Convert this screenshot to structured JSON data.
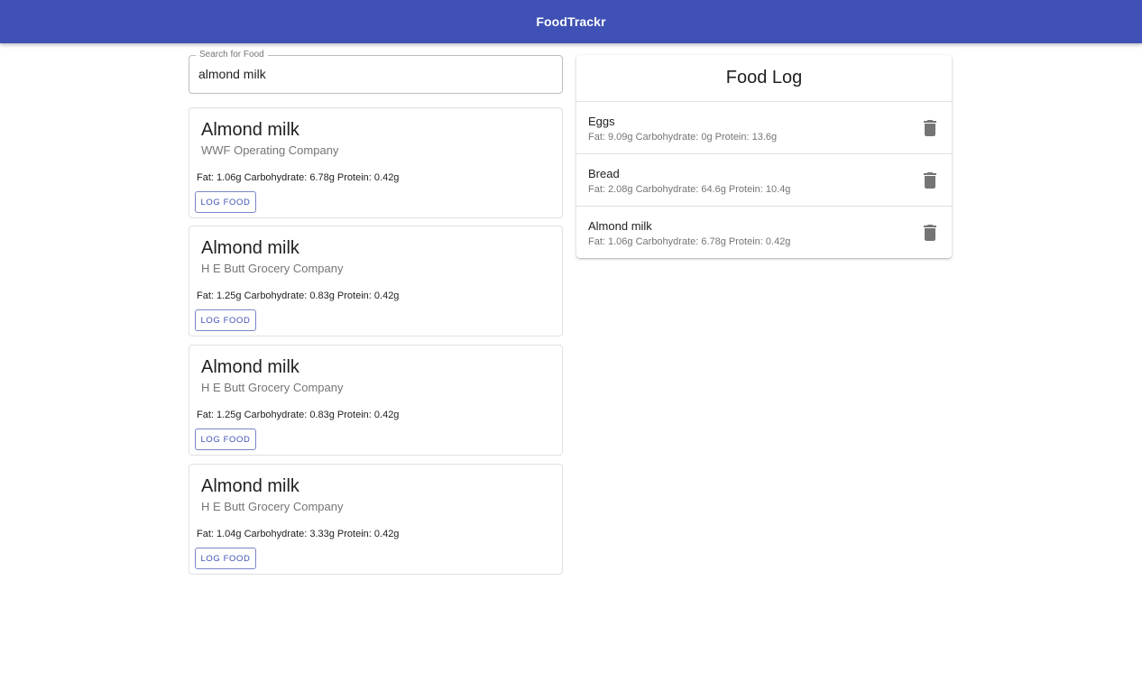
{
  "app": {
    "title": "FoodTrackr",
    "brand_color": "#3f51b5"
  },
  "search": {
    "label": "Search for Food",
    "value": "almond milk"
  },
  "results": [
    {
      "name": "Almond milk",
      "brand": "WWF Operating Company",
      "macros": "Fat: 1.06g Carbohydrate: 6.78g Protein: 0.42g",
      "button_label": "LOG FOOD"
    },
    {
      "name": "Almond milk",
      "brand": "H E Butt Grocery Company",
      "macros": "Fat: 1.25g Carbohydrate: 0.83g Protein: 0.42g",
      "button_label": "LOG FOOD"
    },
    {
      "name": "Almond milk",
      "brand": "H E Butt Grocery Company",
      "macros": "Fat: 1.25g Carbohydrate: 0.83g Protein: 0.42g",
      "button_label": "LOG FOOD"
    },
    {
      "name": "Almond milk",
      "brand": "H E Butt Grocery Company",
      "macros": "Fat: 1.04g Carbohydrate: 3.33g Protein: 0.42g",
      "button_label": "LOG FOOD"
    }
  ],
  "food_log": {
    "title": "Food Log",
    "delete_icon": "trash-icon",
    "items": [
      {
        "name": "Eggs",
        "macros": "Fat: 9.09g Carbohydrate: 0g Protein: 13.6g"
      },
      {
        "name": "Bread",
        "macros": "Fat: 2.08g Carbohydrate: 64.6g Protein: 10.4g"
      },
      {
        "name": "Almond milk",
        "macros": "Fat: 1.06g Carbohydrate: 6.78g Protein: 0.42g"
      }
    ]
  }
}
